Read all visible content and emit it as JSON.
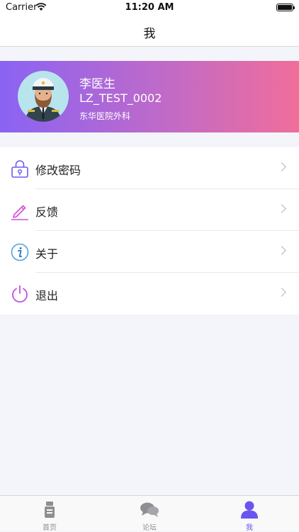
{
  "status_bar": {
    "carrier": "Carrier",
    "time": "11:20 AM"
  },
  "nav": {
    "title": "我"
  },
  "profile": {
    "name": "李医生",
    "user_id": "LZ_TEST_0002",
    "department": "东华医院外科"
  },
  "menu": {
    "items": [
      {
        "label": "修改密码",
        "icon": "lock-icon",
        "color": "#6b5df0"
      },
      {
        "label": "反馈",
        "icon": "pencil-icon",
        "color": "#d04fd6"
      },
      {
        "label": "关于",
        "icon": "info-icon",
        "color": "#4aa3e0"
      },
      {
        "label": "退出",
        "icon": "power-icon",
        "color": "#c24fe0"
      }
    ]
  },
  "tab_bar": {
    "tabs": [
      {
        "label": "首页",
        "icon": "home-icon",
        "active": false
      },
      {
        "label": "论坛",
        "icon": "chat-bubbles-icon",
        "active": false
      },
      {
        "label": "我",
        "icon": "person-icon",
        "active": true
      }
    ]
  },
  "colors": {
    "banner_gradient_start": "#8a63f3",
    "banner_gradient_end": "#f06e9a",
    "active_tab": "#6a55f0"
  }
}
